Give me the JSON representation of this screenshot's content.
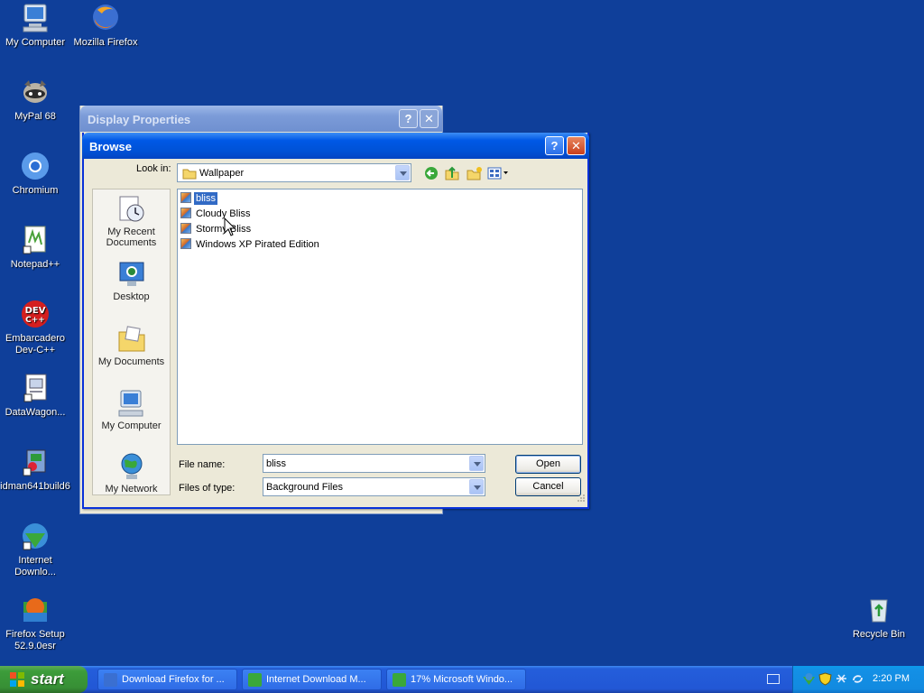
{
  "desktop": {
    "icons": [
      {
        "label": "My Computer"
      },
      {
        "label": "Mozilla Firefox"
      },
      {
        "label": "MyPal 68"
      },
      {
        "label": "Chromium"
      },
      {
        "label": "Notepad++"
      },
      {
        "label": "Embarcadero Dev-C++"
      },
      {
        "label": "DataWagon..."
      },
      {
        "label": "idman641build6"
      },
      {
        "label": "Internet Downlo..."
      },
      {
        "label": "Firefox Setup 52.9.0esr"
      },
      {
        "label": "Recycle Bin"
      }
    ]
  },
  "display_properties": {
    "title": "Display Properties",
    "help_label": "?",
    "close_label": "✕"
  },
  "browse": {
    "title": "Browse",
    "help_label": "?",
    "close_label": "✕",
    "look_in_label": "Look in:",
    "look_in_value": "Wallpaper",
    "places": [
      {
        "label": "My Recent Documents"
      },
      {
        "label": "Desktop"
      },
      {
        "label": "My Documents"
      },
      {
        "label": "My Computer"
      },
      {
        "label": "My Network"
      }
    ],
    "files": [
      {
        "name": "bliss",
        "selected": true
      },
      {
        "name": "Cloudy Bliss",
        "selected": false
      },
      {
        "name": "Stormy Bliss",
        "selected": false
      },
      {
        "name": "Windows XP Pirated Edition",
        "selected": false
      }
    ],
    "file_name_label": "File name:",
    "file_name_value": "bliss",
    "files_of_type_label": "Files of type:",
    "files_of_type_value": "Background Files",
    "open_label": "Open",
    "cancel_label": "Cancel"
  },
  "taskbar": {
    "start_label": "start",
    "tasks": [
      {
        "label": "Download Firefox for ..."
      },
      {
        "label": "Internet Download M..."
      },
      {
        "label": "17% Microsoft Windo..."
      }
    ],
    "clock": "2:20 PM"
  },
  "colors": {
    "desktop": "#0f3f9a",
    "title_active": "#0058e6",
    "selection": "#316ac5"
  }
}
